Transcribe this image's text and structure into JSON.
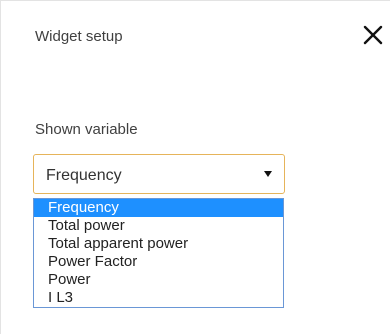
{
  "dialog": {
    "title": "Widget setup",
    "close_icon": "close-icon"
  },
  "field": {
    "label": "Shown variable",
    "selected": "Frequency",
    "options": [
      "Frequency",
      "Total power",
      "Total apparent power",
      "Power Factor",
      "Power",
      "I L3"
    ]
  },
  "colors": {
    "select_border": "#e6b45a",
    "dropdown_border": "#6a97d6",
    "highlight": "#1e90ff"
  }
}
